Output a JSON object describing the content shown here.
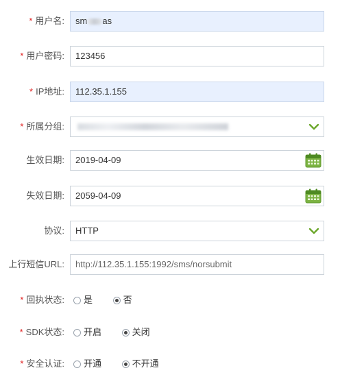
{
  "form": {
    "username": {
      "label": "用户名:",
      "value_prefix": "sm",
      "value_suffix": "as",
      "required": true
    },
    "password": {
      "label": "用户密码:",
      "value": "123456",
      "required": true
    },
    "ip": {
      "label": "IP地址:",
      "value": "112.35.1.155",
      "required": true
    },
    "group": {
      "label": "所属分组:",
      "required": true
    },
    "start_date": {
      "label": "生效日期:",
      "value": "2019-04-09"
    },
    "end_date": {
      "label": "失效日期:",
      "value": "2059-04-09"
    },
    "protocol": {
      "label": "协议:",
      "value": "HTTP"
    },
    "upstream_url": {
      "label": "上行短信URL:",
      "value": "http://112.35.1.155:1992/sms/norsubmit"
    },
    "receipt_status": {
      "label": "回执状态:",
      "required": true,
      "options": [
        "是",
        "否"
      ],
      "selected": "否"
    },
    "sdk_status": {
      "label": "SDK状态:",
      "required": true,
      "options": [
        "开启",
        "关闭"
      ],
      "selected": "关闭"
    },
    "security_auth": {
      "label": "安全认证:",
      "required": true,
      "options": [
        "开通",
        "不开通"
      ],
      "selected": "不开通"
    },
    "required_mark": "*"
  },
  "colors": {
    "required": "#e02020",
    "highlight_bg": "#e8f0fe",
    "accent_green": "#6aa629"
  },
  "icons": {
    "select_arrow": "chevron-down-icon",
    "date_picker": "calendar-icon"
  }
}
